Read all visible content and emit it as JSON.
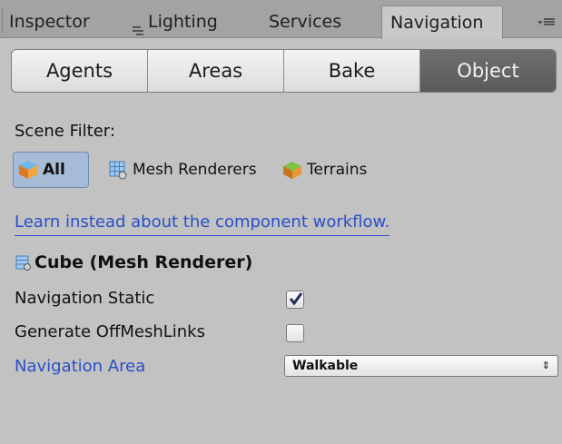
{
  "tabs": [
    {
      "label": "Inspector",
      "active": false
    },
    {
      "label": "Lighting",
      "icon": "lighting-icon",
      "active": false
    },
    {
      "label": "Services",
      "active": false
    },
    {
      "label": "Navigation",
      "active": true
    }
  ],
  "toolbar": {
    "items": [
      "Agents",
      "Areas",
      "Bake",
      "Object"
    ],
    "active": "Object"
  },
  "scene_filter": {
    "label": "Scene Filter:",
    "options": [
      {
        "label": "All",
        "icon": "cube-icon",
        "selected": true
      },
      {
        "label": "Mesh Renderers",
        "icon": "mesh-renderer-icon",
        "selected": false
      },
      {
        "label": "Terrains",
        "icon": "terrain-icon",
        "selected": false
      }
    ]
  },
  "workflow_link": "Learn instead about the component workflow.",
  "object": {
    "title": "Cube (Mesh Renderer)",
    "icon": "mesh-renderer-icon",
    "navigation_static": {
      "label": "Navigation Static",
      "checked": true
    },
    "generate_offmeshlinks": {
      "label": "Generate OffMeshLinks",
      "checked": false
    },
    "navigation_area": {
      "label": "Navigation Area",
      "value": "Walkable"
    }
  },
  "colors": {
    "link": "#2a4fc8",
    "area_label": "#2a4fc8",
    "active_tab_bg": "#5f5f5f",
    "selected_filter": "#a6bcd6"
  }
}
